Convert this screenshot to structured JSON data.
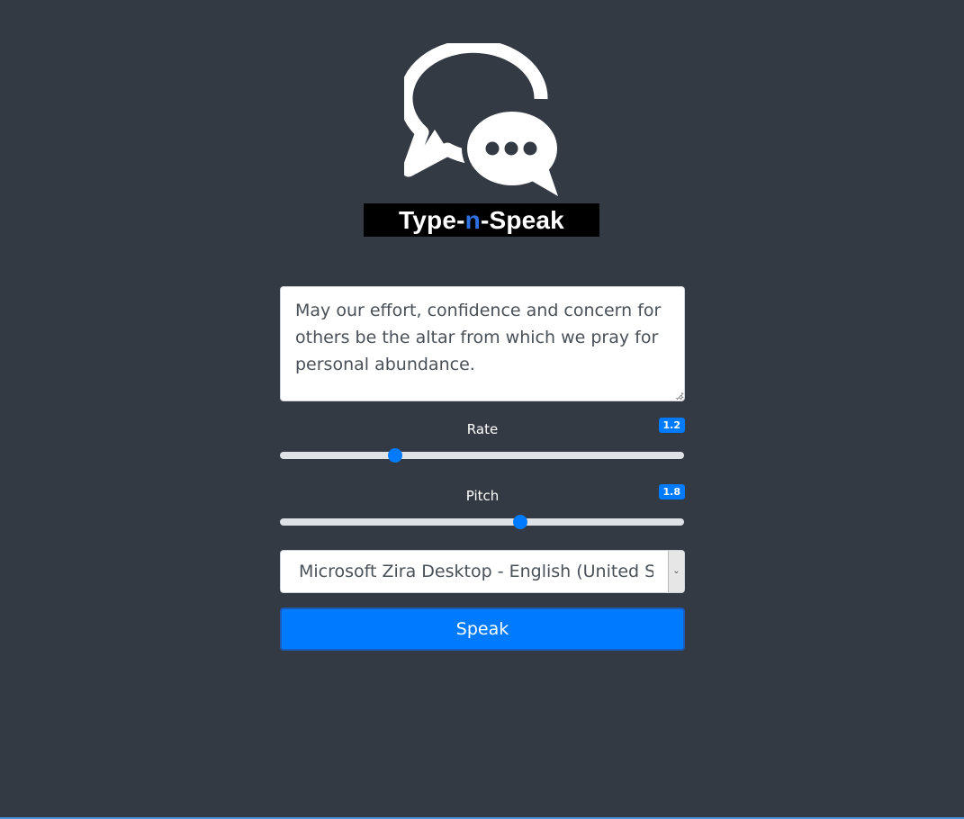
{
  "logo": {
    "prefix": "Type-",
    "accent": "n",
    "suffix": "-Speak",
    "icon": "speech-bubbles-icon"
  },
  "text_input": {
    "value": "May our effort, confidence and concern for others be the altar from which we pray for personal abundance."
  },
  "rate": {
    "label": "Rate",
    "value": "1.2",
    "min": 0.5,
    "max": 2,
    "fraction": 0.286
  },
  "pitch": {
    "label": "Pitch",
    "value": "1.8",
    "min": 0,
    "max": 2,
    "fraction": 0.595
  },
  "voice_select": {
    "selected": "Microsoft Zira Desktop - English (United States)",
    "arrow_icon": "chevron-down-icon"
  },
  "speak_button": {
    "label": "Speak"
  },
  "colors": {
    "background": "#343a44",
    "accent": "#007bff",
    "logo_accent": "#2f6fe0",
    "banner": "#000000"
  }
}
